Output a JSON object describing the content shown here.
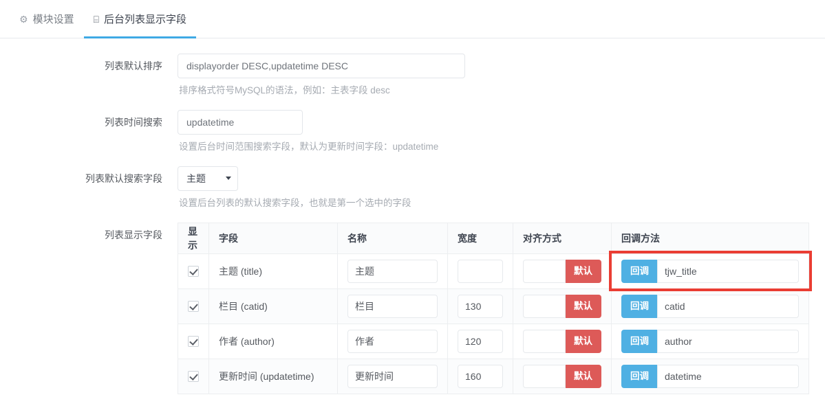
{
  "tabs": [
    {
      "label": "模块设置",
      "icon": "gear-icon",
      "glyph": "⚙",
      "active": false
    },
    {
      "label": "后台列表显示字段",
      "icon": "table-grid-icon",
      "glyph": "⌸",
      "active": true
    }
  ],
  "form": {
    "sort": {
      "label": "列表默认排序",
      "value": "displayorder DESC,updatetime DESC",
      "placeholder": "displayorder DESC,updatetime DESC",
      "help": "排序格式符号MySQL的语法，例如：主表字段 desc"
    },
    "time_search": {
      "label": "列表时间搜索",
      "value": "updatetime",
      "placeholder": "updatetime",
      "help": "设置后台时间范围搜索字段，默认为更新时间字段：updatetime"
    },
    "default_search_field": {
      "label": "列表默认搜索字段",
      "selected": "主题",
      "options": [
        "主题"
      ],
      "help": "设置后台列表的默认搜索字段，也就是第一个选中的字段"
    },
    "display_fields": {
      "label": "列表显示字段"
    }
  },
  "table": {
    "headers": [
      "显示",
      "字段",
      "名称",
      "宽度",
      "对齐方式",
      "回调方法"
    ],
    "default_button_label": "默认",
    "callback_button_label": "回调",
    "rows": [
      {
        "checked": true,
        "field": "主题 (title)",
        "name": "主题",
        "width": "",
        "align": "",
        "callback": "tjw_title",
        "highlighted": true
      },
      {
        "checked": true,
        "field": "栏目 (catid)",
        "name": "栏目",
        "width": "130",
        "align": "",
        "callback": "catid",
        "highlighted": false
      },
      {
        "checked": true,
        "field": "作者 (author)",
        "name": "作者",
        "width": "120",
        "align": "",
        "callback": "author",
        "highlighted": false
      },
      {
        "checked": true,
        "field": "更新时间 (updatetime)",
        "name": "更新时间",
        "width": "160",
        "align": "",
        "callback": "datetime",
        "highlighted": false
      }
    ]
  },
  "colors": {
    "accent_blue": "#3fa9e5",
    "callback_blue": "#4fb0e3",
    "danger_red": "#dd5a58",
    "highlight_red": "#ea3d33"
  }
}
